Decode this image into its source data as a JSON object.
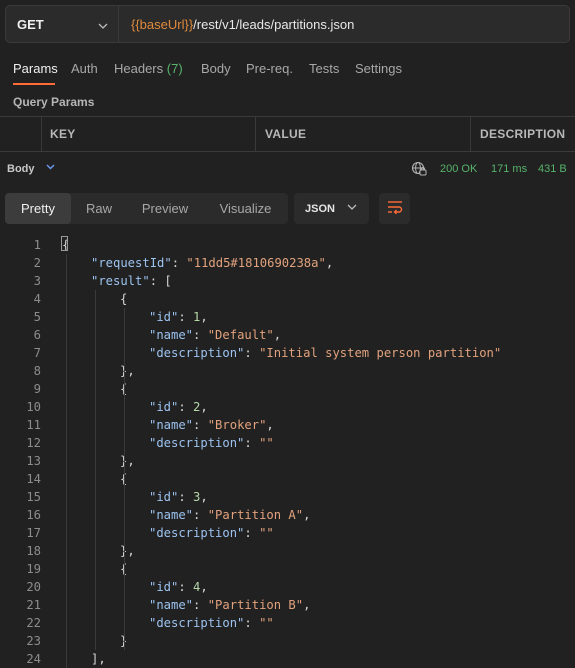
{
  "request": {
    "method": "GET",
    "url_variable": "{{baseUrl}}",
    "url_path": "/rest/v1/leads/partitions.json"
  },
  "tabs": [
    {
      "label": "Params"
    },
    {
      "label": "Auth"
    },
    {
      "label": "Headers",
      "count": "(7)"
    },
    {
      "label": "Body"
    },
    {
      "label": "Pre-req."
    },
    {
      "label": "Tests"
    },
    {
      "label": "Settings"
    }
  ],
  "query_params": {
    "title": "Query Params",
    "columns": [
      "KEY",
      "VALUE",
      "DESCRIPTION"
    ]
  },
  "response": {
    "body_label": "Body",
    "status": "200 OK",
    "time": "171 ms",
    "size": "431 B",
    "view_tabs": [
      "Pretty",
      "Raw",
      "Preview",
      "Visualize"
    ],
    "active_view": "Pretty",
    "format": "JSON"
  },
  "code_lines": [
    [
      [
        "p",
        "{"
      ]
    ],
    [
      [
        "k",
        "\"requestId\""
      ],
      [
        "p",
        ": "
      ],
      [
        "s",
        "\"11dd5#1810690238a\""
      ],
      [
        "p",
        ","
      ]
    ],
    [
      [
        "k",
        "\"result\""
      ],
      [
        "p",
        ": ["
      ]
    ],
    [
      [
        "p",
        "{"
      ]
    ],
    [
      [
        "k",
        "\"id\""
      ],
      [
        "p",
        ": "
      ],
      [
        "n",
        "1"
      ],
      [
        "p",
        ","
      ]
    ],
    [
      [
        "k",
        "\"name\""
      ],
      [
        "p",
        ": "
      ],
      [
        "s",
        "\"Default\""
      ],
      [
        "p",
        ","
      ]
    ],
    [
      [
        "k",
        "\"description\""
      ],
      [
        "p",
        ": "
      ],
      [
        "s",
        "\"Initial system person partition\""
      ]
    ],
    [
      [
        "p",
        "},"
      ]
    ],
    [
      [
        "p",
        "{"
      ]
    ],
    [
      [
        "k",
        "\"id\""
      ],
      [
        "p",
        ": "
      ],
      [
        "n",
        "2"
      ],
      [
        "p",
        ","
      ]
    ],
    [
      [
        "k",
        "\"name\""
      ],
      [
        "p",
        ": "
      ],
      [
        "s",
        "\"Broker\""
      ],
      [
        "p",
        ","
      ]
    ],
    [
      [
        "k",
        "\"description\""
      ],
      [
        "p",
        ": "
      ],
      [
        "s",
        "\"\""
      ]
    ],
    [
      [
        "p",
        "},"
      ]
    ],
    [
      [
        "p",
        "{"
      ]
    ],
    [
      [
        "k",
        "\"id\""
      ],
      [
        "p",
        ": "
      ],
      [
        "n",
        "3"
      ],
      [
        "p",
        ","
      ]
    ],
    [
      [
        "k",
        "\"name\""
      ],
      [
        "p",
        ": "
      ],
      [
        "s",
        "\"Partition A\""
      ],
      [
        "p",
        ","
      ]
    ],
    [
      [
        "k",
        "\"description\""
      ],
      [
        "p",
        ": "
      ],
      [
        "s",
        "\"\""
      ]
    ],
    [
      [
        "p",
        "},"
      ]
    ],
    [
      [
        "p",
        "{"
      ]
    ],
    [
      [
        "k",
        "\"id\""
      ],
      [
        "p",
        ": "
      ],
      [
        "n",
        "4"
      ],
      [
        "p",
        ","
      ]
    ],
    [
      [
        "k",
        "\"name\""
      ],
      [
        "p",
        ": "
      ],
      [
        "s",
        "\"Partition B\""
      ],
      [
        "p",
        ","
      ]
    ],
    [
      [
        "k",
        "\"description\""
      ],
      [
        "p",
        ": "
      ],
      [
        "s",
        "\"\""
      ]
    ],
    [
      [
        "p",
        "}"
      ]
    ],
    [
      [
        "p",
        "],"
      ]
    ]
  ],
  "code_indent_levels": [
    0,
    1,
    1,
    2,
    3,
    3,
    3,
    2,
    2,
    3,
    3,
    3,
    2,
    2,
    3,
    3,
    3,
    2,
    2,
    3,
    3,
    3,
    2,
    1
  ],
  "colors": {
    "accent": "#ff6c37",
    "url_variable": "#e08a3c",
    "status_green": "#57b36b",
    "json_key": "#9cc3f0",
    "json_string": "#e2a27d",
    "json_number": "#b6d7a8"
  }
}
